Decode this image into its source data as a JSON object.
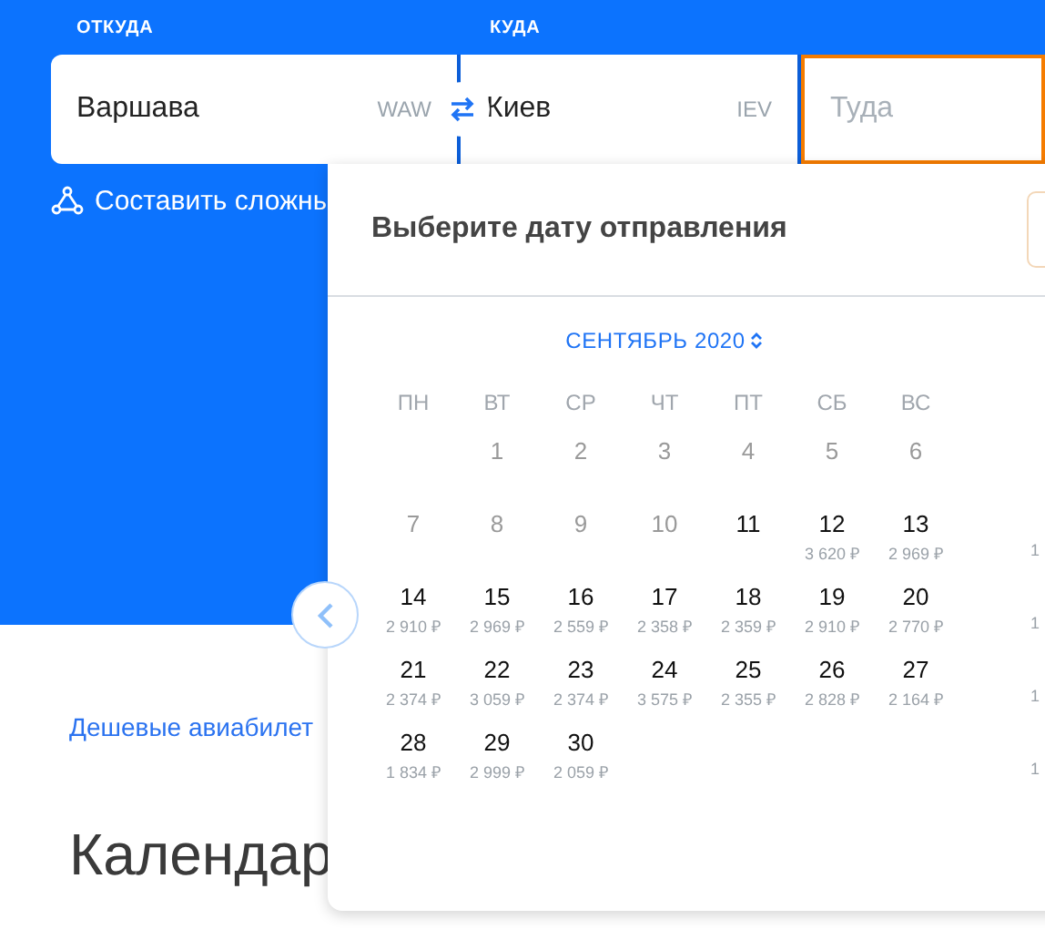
{
  "search": {
    "from": {
      "label": "ОТКУДА",
      "value": "Варшава",
      "code": "WAW"
    },
    "to": {
      "label": "КУДА",
      "value": "Киев",
      "code": "IEV"
    },
    "date": {
      "placeholder": "Туда",
      "focused": true
    },
    "complex_route": "Составить сложны"
  },
  "page": {
    "link": "Дешевые авиабилет",
    "heading": "Календар"
  },
  "calendar": {
    "title": "Выберите дату отправления",
    "month": "СЕНТЯБРЬ 2020",
    "weekdays": [
      "ПН",
      "ВТ",
      "СР",
      "ЧТ",
      "ПТ",
      "СБ",
      "ВС"
    ],
    "weeks": [
      [
        {
          "day": "1",
          "disabled": true
        },
        {
          "day": "2",
          "disabled": true
        },
        {
          "day": "3",
          "disabled": true
        },
        {
          "day": "4",
          "disabled": true
        },
        {
          "day": "5",
          "disabled": true
        },
        {
          "day": "6",
          "disabled": true
        }
      ],
      [
        {
          "day": "7",
          "disabled": true
        },
        {
          "day": "8",
          "disabled": true
        },
        {
          "day": "9",
          "disabled": true
        },
        {
          "day": "10",
          "disabled": true
        },
        {
          "day": "11",
          "disabled": false
        },
        {
          "day": "12",
          "disabled": false,
          "price": "3 620 ₽"
        },
        {
          "day": "13",
          "disabled": false,
          "price": "2 969 ₽"
        }
      ],
      [
        {
          "day": "14",
          "disabled": false,
          "price": "2 910 ₽"
        },
        {
          "day": "15",
          "disabled": false,
          "price": "2 969 ₽"
        },
        {
          "day": "16",
          "disabled": false,
          "price": "2 559 ₽"
        },
        {
          "day": "17",
          "disabled": false,
          "price": "2 358 ₽"
        },
        {
          "day": "18",
          "disabled": false,
          "price": "2 359 ₽"
        },
        {
          "day": "19",
          "disabled": false,
          "price": "2 910 ₽"
        },
        {
          "day": "20",
          "disabled": false,
          "price": "2 770 ₽"
        }
      ],
      [
        {
          "day": "21",
          "disabled": false,
          "price": "2 374 ₽"
        },
        {
          "day": "22",
          "disabled": false,
          "price": "3 059 ₽"
        },
        {
          "day": "23",
          "disabled": false,
          "price": "2 374 ₽"
        },
        {
          "day": "24",
          "disabled": false,
          "price": "3 575 ₽"
        },
        {
          "day": "25",
          "disabled": false,
          "price": "2 355 ₽"
        },
        {
          "day": "26",
          "disabled": false,
          "price": "2 828 ₽"
        },
        {
          "day": "27",
          "disabled": false,
          "price": "2 164 ₽"
        }
      ],
      [
        {
          "day": "28",
          "disabled": false,
          "price": "1 834 ₽"
        },
        {
          "day": "29",
          "disabled": false,
          "price": "2 999 ₽"
        },
        {
          "day": "30",
          "disabled": false,
          "price": "2 059 ₽"
        }
      ]
    ],
    "next_month_edge": [
      "1",
      "1",
      "1",
      "1"
    ]
  }
}
